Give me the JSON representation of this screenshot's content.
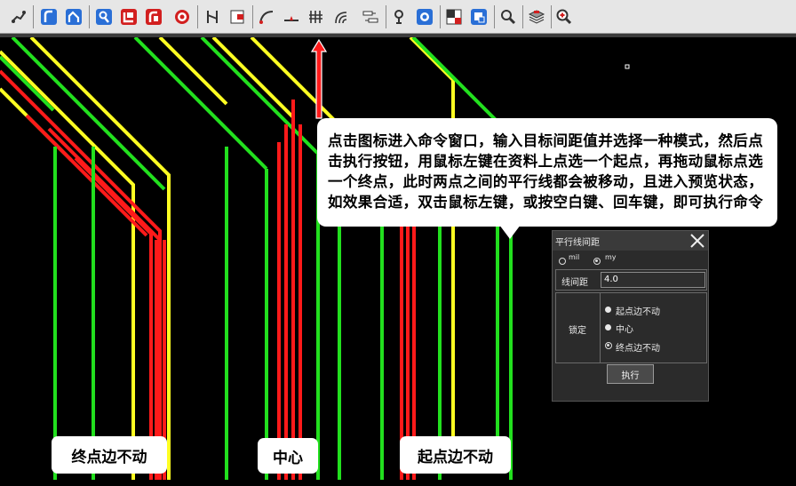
{
  "toolbar": {
    "icons": [
      "route-wire-icon",
      "route-curve-icon",
      "route-bend-icon",
      "probe-icon",
      "box-select-icon",
      "push-icon",
      "target-icon",
      "swap-icon",
      "cut-icon",
      "arc-icon",
      "gap-icon",
      "parallel-spacing-icon",
      "wave-icon",
      "fanout-icon",
      "pin-probe-icon",
      "fit-icon",
      "corner-icon",
      "select-square-icon",
      "zoom-icon",
      "layers-icon",
      "zoom-in-icon"
    ]
  },
  "callout": {
    "text": "点击图标进入命令窗口，输入目标间距值并选择一种模式，然后点击执行按钮，用鼠标左键在资料上点选一个起点，再拖动鼠标点选一个终点，此时两点之间的平行线都会被移动，且进入预览状态，如效果合适，双击鼠标左键，或按空白键、回车键，即可执行命令"
  },
  "labels": {
    "end_fixed": "终点边不动",
    "center": "中心",
    "start_fixed": "起点边不动"
  },
  "dialog": {
    "title": "平行线间距",
    "unit_mil": "mil",
    "unit_my": "my",
    "spacing_label": "线间距",
    "spacing_value": "4.0",
    "lock_label": "锁定",
    "option_start": "起点边不动",
    "option_center": "中心",
    "option_end": "终点边不动",
    "execute": "执行"
  },
  "colors": {
    "green": "#22e01e",
    "yellow": "#ffff22",
    "red": "#ff1a1a",
    "accent_blue": "#2a6fd6",
    "accent_red": "#d21f1f"
  }
}
